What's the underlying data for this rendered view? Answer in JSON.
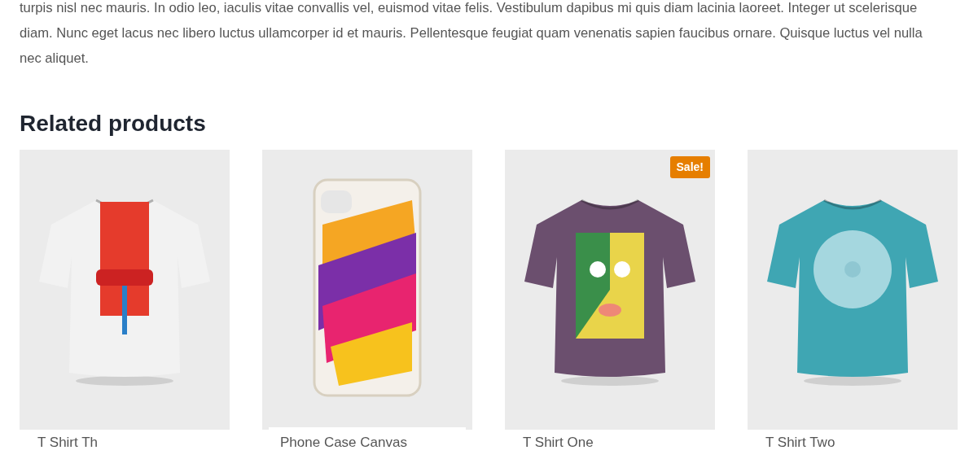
{
  "description": "turpis nisl nec mauris. In odio leo, iaculis vitae convallis vel, euismod vitae felis. Vestibulum dapibus mi quis diam lacinia laoreet. Integer ut scelerisque diam. Nunc eget lacus nec libero luctus ullamcorper id et mauris. Pellentesque feugiat quam venenatis sapien faucibus ornare. Quisque luctus vel nulla nec aliquet.",
  "related": {
    "heading": "Related products",
    "products": [
      {
        "name": "T Shirt Th",
        "kind": "tshirt",
        "color": "#f2f2f2"
      },
      {
        "name": "Phone Case Canvas",
        "kind": "phone-case"
      },
      {
        "name": "T Shirt One",
        "kind": "tshirt",
        "color": "#6b4f6e",
        "badge": "Sale!"
      },
      {
        "name": "T Shirt Two",
        "kind": "tshirt",
        "color": "#3fa6b3"
      }
    ]
  }
}
